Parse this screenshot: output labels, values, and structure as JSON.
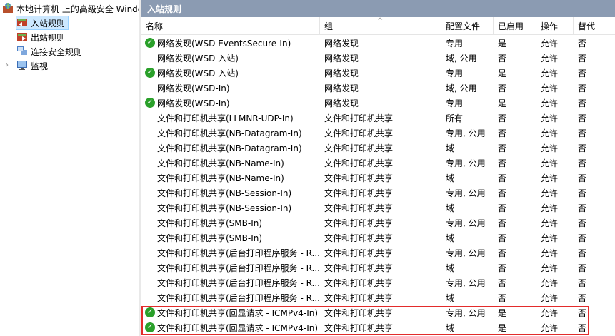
{
  "tree": {
    "root_label": "本地计算机 上的高级安全 Windows",
    "items": [
      {
        "label": "入站规则",
        "icon": "inbound-rules-icon",
        "selected": true
      },
      {
        "label": "出站规则",
        "icon": "outbound-rules-icon",
        "selected": false
      },
      {
        "label": "连接安全规则",
        "icon": "connection-security-icon",
        "selected": false
      },
      {
        "label": "监视",
        "icon": "monitor-icon",
        "selected": false
      }
    ]
  },
  "pane": {
    "title": "入站规则"
  },
  "columns": {
    "name": "名称",
    "group": "组",
    "profile": "配置文件",
    "enabled": "已启用",
    "action": "操作",
    "override": "替代"
  },
  "rows": [
    {
      "enabled_icon": true,
      "name": "网络发现(WSD EventsSecure-In)",
      "group": "网络发现",
      "profile": "专用",
      "enabled": "是",
      "action": "允许",
      "override": "否"
    },
    {
      "enabled_icon": false,
      "name": "网络发现(WSD 入站)",
      "group": "网络发现",
      "profile": "域, 公用",
      "enabled": "否",
      "action": "允许",
      "override": "否"
    },
    {
      "enabled_icon": true,
      "name": "网络发现(WSD 入站)",
      "group": "网络发现",
      "profile": "专用",
      "enabled": "是",
      "action": "允许",
      "override": "否"
    },
    {
      "enabled_icon": false,
      "name": "网络发现(WSD-In)",
      "group": "网络发现",
      "profile": "域, 公用",
      "enabled": "否",
      "action": "允许",
      "override": "否"
    },
    {
      "enabled_icon": true,
      "name": "网络发现(WSD-In)",
      "group": "网络发现",
      "profile": "专用",
      "enabled": "是",
      "action": "允许",
      "override": "否"
    },
    {
      "enabled_icon": false,
      "name": "文件和打印机共享(LLMNR-UDP-In)",
      "group": "文件和打印机共享",
      "profile": "所有",
      "enabled": "否",
      "action": "允许",
      "override": "否"
    },
    {
      "enabled_icon": false,
      "name": "文件和打印机共享(NB-Datagram-In)",
      "group": "文件和打印机共享",
      "profile": "专用, 公用",
      "enabled": "否",
      "action": "允许",
      "override": "否"
    },
    {
      "enabled_icon": false,
      "name": "文件和打印机共享(NB-Datagram-In)",
      "group": "文件和打印机共享",
      "profile": "域",
      "enabled": "否",
      "action": "允许",
      "override": "否"
    },
    {
      "enabled_icon": false,
      "name": "文件和打印机共享(NB-Name-In)",
      "group": "文件和打印机共享",
      "profile": "专用, 公用",
      "enabled": "否",
      "action": "允许",
      "override": "否"
    },
    {
      "enabled_icon": false,
      "name": "文件和打印机共享(NB-Name-In)",
      "group": "文件和打印机共享",
      "profile": "域",
      "enabled": "否",
      "action": "允许",
      "override": "否"
    },
    {
      "enabled_icon": false,
      "name": "文件和打印机共享(NB-Session-In)",
      "group": "文件和打印机共享",
      "profile": "专用, 公用",
      "enabled": "否",
      "action": "允许",
      "override": "否"
    },
    {
      "enabled_icon": false,
      "name": "文件和打印机共享(NB-Session-In)",
      "group": "文件和打印机共享",
      "profile": "域",
      "enabled": "否",
      "action": "允许",
      "override": "否"
    },
    {
      "enabled_icon": false,
      "name": "文件和打印机共享(SMB-In)",
      "group": "文件和打印机共享",
      "profile": "专用, 公用",
      "enabled": "否",
      "action": "允许",
      "override": "否"
    },
    {
      "enabled_icon": false,
      "name": "文件和打印机共享(SMB-In)",
      "group": "文件和打印机共享",
      "profile": "域",
      "enabled": "否",
      "action": "允许",
      "override": "否"
    },
    {
      "enabled_icon": false,
      "name": "文件和打印机共享(后台打印程序服务 - R...",
      "group": "文件和打印机共享",
      "profile": "专用, 公用",
      "enabled": "否",
      "action": "允许",
      "override": "否"
    },
    {
      "enabled_icon": false,
      "name": "文件和打印机共享(后台打印程序服务 - R...",
      "group": "文件和打印机共享",
      "profile": "域",
      "enabled": "否",
      "action": "允许",
      "override": "否"
    },
    {
      "enabled_icon": false,
      "name": "文件和打印机共享(后台打印程序服务 - R...",
      "group": "文件和打印机共享",
      "profile": "专用, 公用",
      "enabled": "否",
      "action": "允许",
      "override": "否"
    },
    {
      "enabled_icon": false,
      "name": "文件和打印机共享(后台打印程序服务 - R...",
      "group": "文件和打印机共享",
      "profile": "域",
      "enabled": "否",
      "action": "允许",
      "override": "否"
    },
    {
      "enabled_icon": true,
      "name": "文件和打印机共享(回显请求 - ICMPv4-In)",
      "group": "文件和打印机共享",
      "profile": "专用, 公用",
      "enabled": "是",
      "action": "允许",
      "override": "否"
    },
    {
      "enabled_icon": true,
      "name": "文件和打印机共享(回显请求 - ICMPv4-In)",
      "group": "文件和打印机共享",
      "profile": "域",
      "enabled": "是",
      "action": "允许",
      "override": "否"
    }
  ],
  "colors": {
    "pane_title_bg": "#8b9bb2",
    "selected_bg": "#cce8ff",
    "enabled_check": "#2aa02a",
    "highlight_border": "#e32b2b"
  }
}
